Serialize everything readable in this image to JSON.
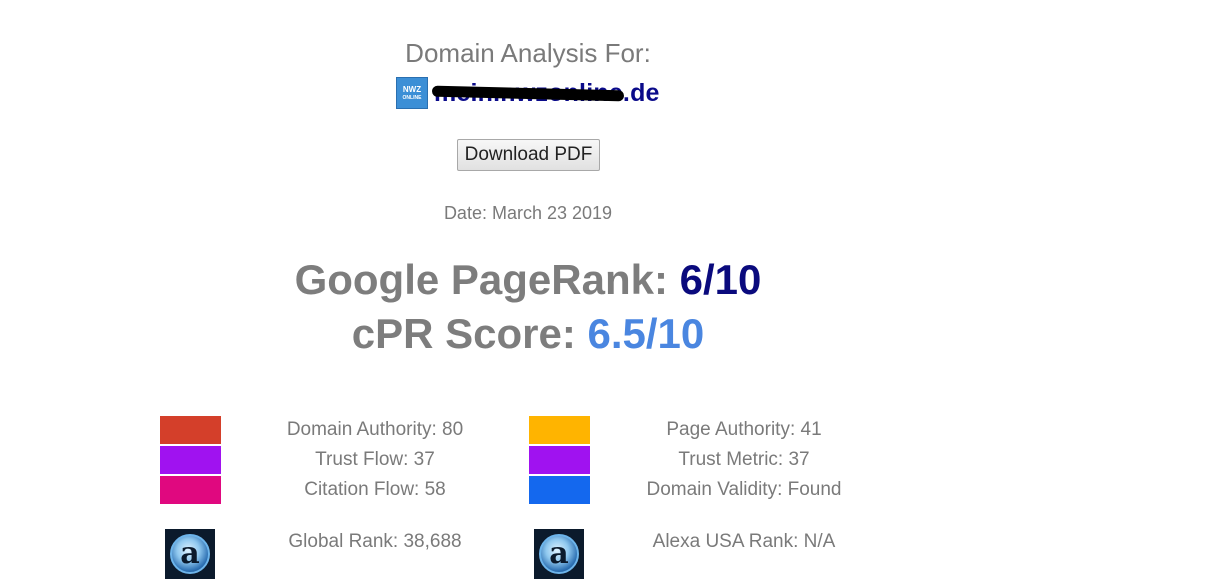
{
  "header": {
    "heading": "Domain Analysis For:",
    "logo_text_top": "NWZ",
    "logo_text_bottom": "ONLINE",
    "domain": "mein.nwzonline.de"
  },
  "actions": {
    "download_label": "Download PDF"
  },
  "report": {
    "date": "Date: March 23 2019"
  },
  "scores": {
    "pagerank_label": "Google PageRank: ",
    "pagerank_value": "6/10",
    "cpr_label": "cPR Score: ",
    "cpr_value": "6.5/10"
  },
  "metrics": {
    "domain_authority": "Domain Authority: 80",
    "trust_flow": "Trust Flow: 37",
    "citation_flow": "Citation Flow: 58",
    "page_authority": "Page Authority: 41",
    "trust_metric": "Trust Metric: 37",
    "domain_validity": "Domain Validity: Found",
    "global_rank": "Global Rank: 38,688",
    "alexa_usa_rank": "Alexa USA Rank: N/A",
    "alexa_glyph": "a"
  },
  "colors": {
    "domain_authority": "#d43f2a",
    "trust_flow": "#a012f0",
    "citation_flow": "#e0087f",
    "page_authority": "#ffb400",
    "trust_metric": "#a012f0",
    "domain_validity": "#1468ee"
  }
}
